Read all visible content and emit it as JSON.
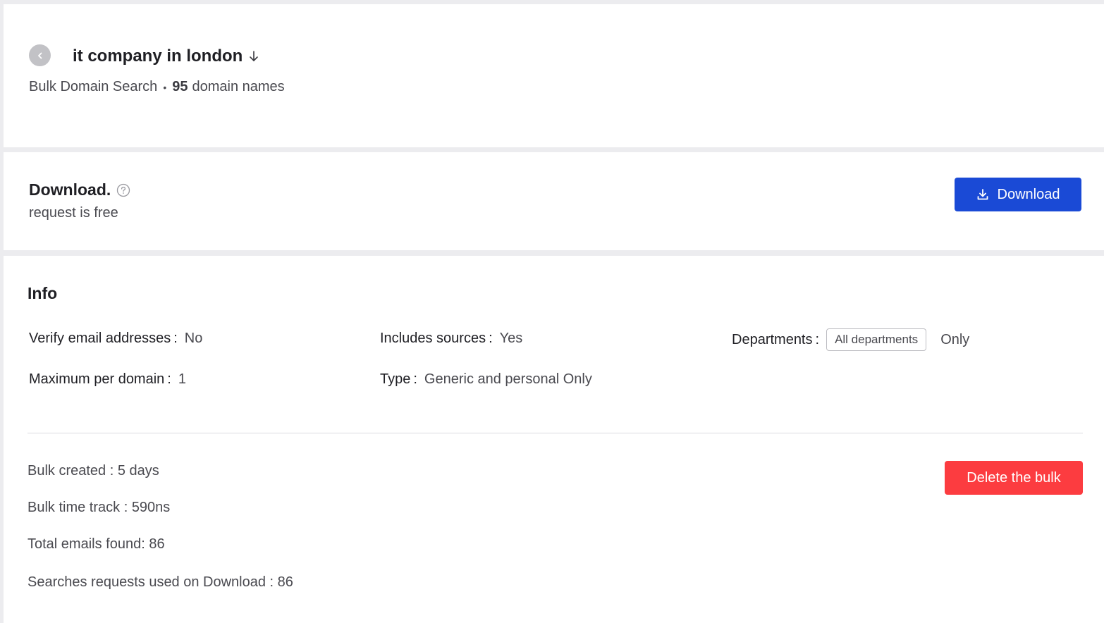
{
  "header": {
    "title": "it company in london",
    "subtitle_type": "Bulk Domain Search",
    "subtitle_dot": "•",
    "domain_count": "95",
    "domain_label": "domain names"
  },
  "download": {
    "title": "Download.",
    "subtitle": "request is free",
    "button_label": "Download"
  },
  "info": {
    "title": "Info",
    "fields": {
      "verify": {
        "label": "Verify email addresses",
        "sep": ":",
        "value": "No"
      },
      "sources": {
        "label": "Includes sources",
        "sep": ":",
        "value": "Yes"
      },
      "departments": {
        "label": "Departments",
        "sep": ":",
        "tag": "All departments",
        "suffix": "Only"
      },
      "max_per_domain": {
        "label": "Maximum per domain",
        "sep": ":",
        "value": "1"
      },
      "type": {
        "label": "Type",
        "sep": ":",
        "value": "Generic and personal Only"
      }
    },
    "stats": {
      "created": "Bulk created : 5 days",
      "time_track": "Bulk time track : 590ns",
      "emails_found": "Total emails found: 86",
      "requests_used": "Searches requests used on Download : 86"
    },
    "delete_label": "Delete the bulk"
  },
  "colors": {
    "primary": "#1a4ad6",
    "danger": "#fc3c40",
    "background": "#ececef"
  },
  "icons": [
    "back-chevron-icon",
    "sort-down-arrow-icon",
    "help-circle-icon",
    "download-icon"
  ]
}
